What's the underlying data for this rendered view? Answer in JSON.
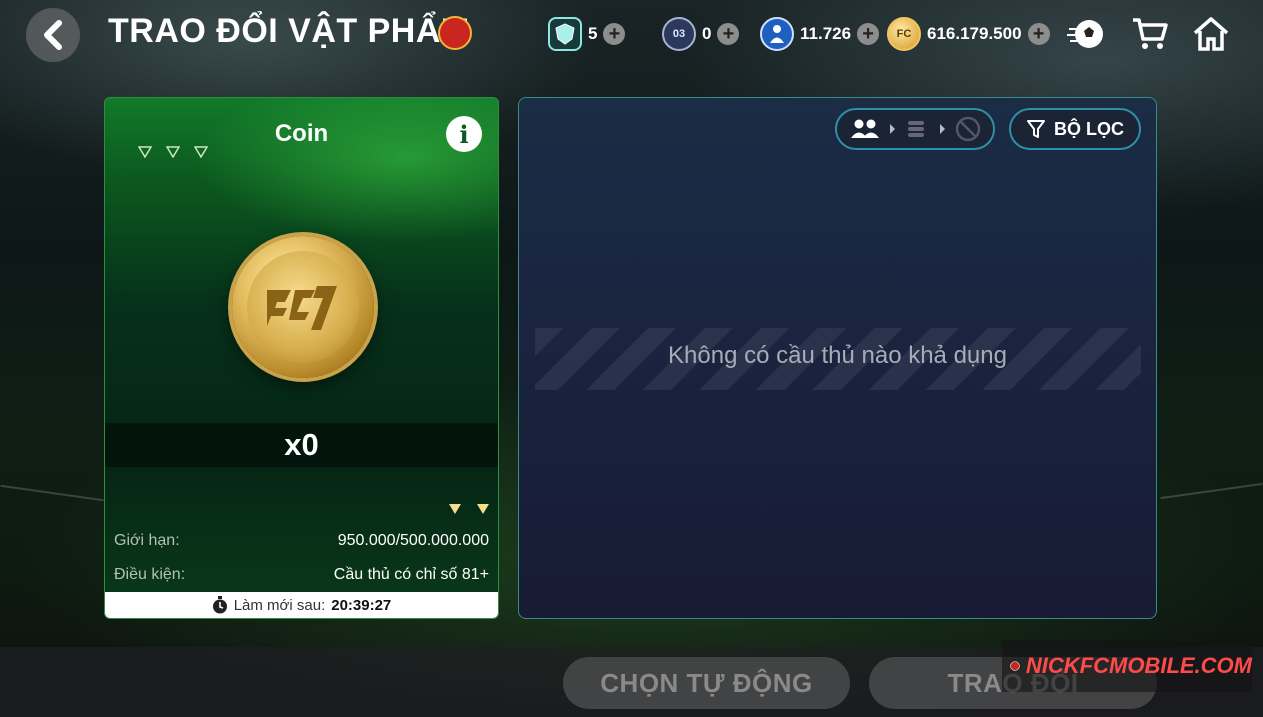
{
  "header": {
    "title": "TRAO ĐỔI VẬT PHẨM",
    "resources": [
      {
        "name": "gem-shield",
        "amount": "5"
      },
      {
        "name": "pack-card",
        "amount": "0",
        "icon_label": "03"
      },
      {
        "name": "player-points",
        "amount": "11.726"
      },
      {
        "name": "fc-coin",
        "amount": "616.179.500"
      }
    ]
  },
  "card": {
    "title": "Coin",
    "info_glyph": "i",
    "quantity": "x0",
    "limit_label": "Giới hạn:",
    "limit_value": "950.000/500.000.000",
    "condition_label": "Điều kiện:",
    "condition_value": "Cầu thủ có chỉ số 81+",
    "refresh_label": "Làm mới sau:",
    "refresh_time": "20:39:27"
  },
  "panel": {
    "filter_label": "BỘ LỌC",
    "empty_message": "Không có cầu thủ nào khả dụng"
  },
  "actions": {
    "auto_select": "CHỌN TỰ ĐỘNG",
    "exchange": "TRAO ĐỔI"
  },
  "watermark": "NICKFCMOBILE.COM",
  "colors": {
    "card_green": "#0c5a1f",
    "panel_border": "#3a8a8a",
    "gold": "#d6ad4c"
  }
}
